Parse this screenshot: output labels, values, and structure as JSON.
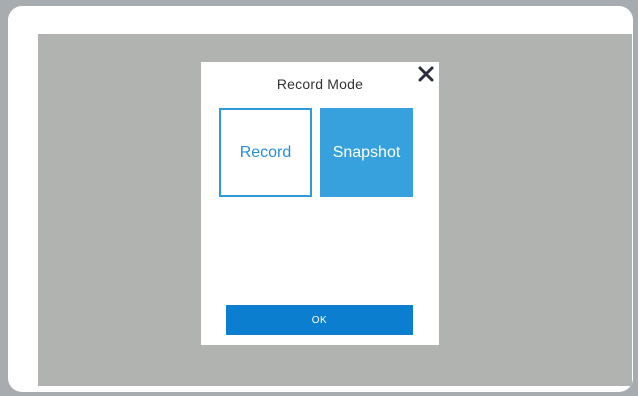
{
  "dialog": {
    "title": "Record Mode",
    "close_icon": "close-icon",
    "modes": [
      {
        "label": "Record",
        "selected": true
      },
      {
        "label": "Snapshot",
        "selected": false
      }
    ],
    "ok_label": "OK"
  },
  "colors": {
    "accent": "#2f9ad8",
    "snapshot_bg": "#36a1dc",
    "ok_bg": "#0b7ed0",
    "backdrop": "#b1b3b1"
  }
}
